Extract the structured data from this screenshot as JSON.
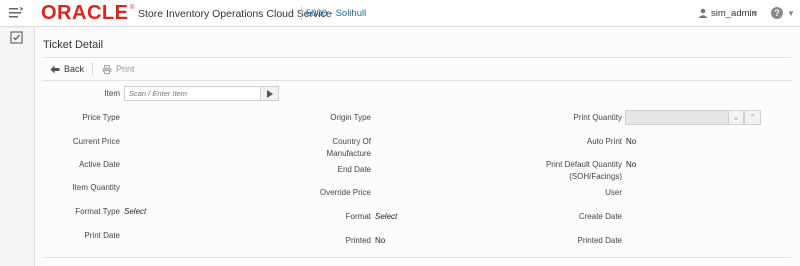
{
  "header": {
    "logo": "ORACLE",
    "registered_mark": "®",
    "app_title": "Store Inventory Operations Cloud Service",
    "store": "5000 - Solihull",
    "user": "sim_admin",
    "help": "?"
  },
  "page": {
    "title": "Ticket Detail"
  },
  "toolbar": {
    "back_label": "Back",
    "print_label": "Print"
  },
  "form": {
    "item_label": "Item",
    "item_placeholder": "Scan / Enter Item",
    "price_type_label": "Price Type",
    "current_price_label": "Current Price",
    "active_date_label": "Active Date",
    "item_quantity_label": "Item Quantity",
    "format_type_label": "Format Type",
    "format_type_value": "Select",
    "print_date_label": "Print Date",
    "origin_type_label": "Origin Type",
    "country_label_line1": "Country Of",
    "country_label_line2": "Manufacture",
    "end_date_label": "End Date",
    "override_price_label": "Override Price",
    "format_label": "Format",
    "format_value": "Select",
    "printed_label": "Printed",
    "printed_value": "No",
    "print_quantity_label": "Print Quantity",
    "auto_print_label": "Auto Print",
    "auto_print_value": "No",
    "print_default_qty_label_line1": "Print Default Quantity",
    "print_default_qty_label_line2": "(SOH/Facings)",
    "print_default_qty_value": "No",
    "user_label": "User",
    "create_date_label": "Create Date",
    "printed_date_label": "Printed Date"
  }
}
